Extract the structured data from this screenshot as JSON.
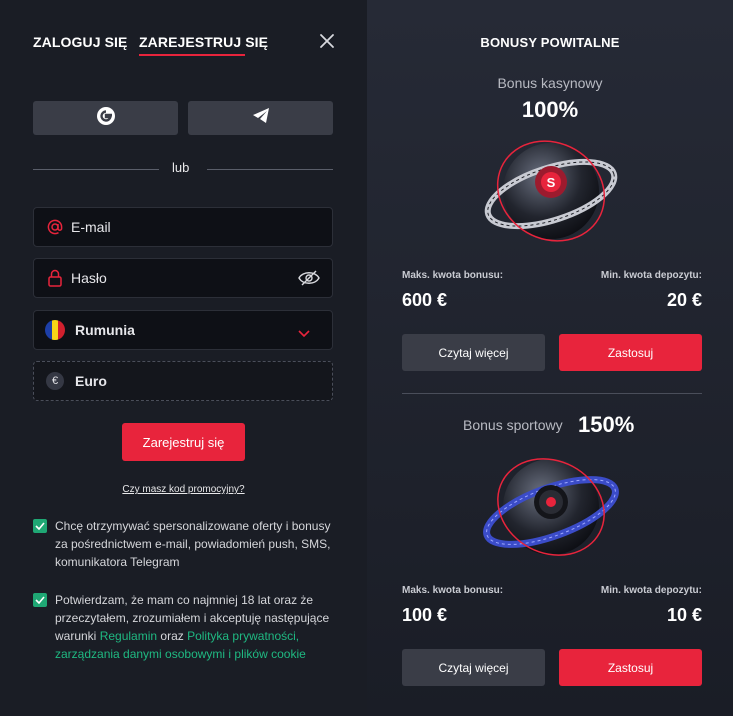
{
  "tabs": {
    "login": "ZALOGUJ SIĘ",
    "register": "ZAREJESTRUJ SIĘ"
  },
  "divider_text": "lub",
  "form": {
    "email_placeholder": "E-mail",
    "password_placeholder": "Hasło",
    "country": "Rumunia",
    "currency": "Euro",
    "currency_symbol": "€",
    "submit": "Zarejestruj się",
    "promo_link": "Czy masz kod promocyjny?"
  },
  "consents": {
    "marketing": "Chcę otrzymywać spersonalizowane oferty i bonusy za pośrednictwem e-mail, powiadomień push, SMS, komunikatora Telegram",
    "terms_prefix": "Potwierdzam, że mam co najmniej 18 lat oraz że przeczytałem, zrozumiałem i akceptuję następujące warunki ",
    "terms_link": "Regulamin",
    "terms_and": " oraz ",
    "privacy_link": "Polityka prywatności, zarządzania danymi osobowymi i plików cookie"
  },
  "bonuses": {
    "title": "BONUSY POWITALNE",
    "casino": {
      "name": "Bonus kasynowy",
      "percent": "100%",
      "max_label": "Maks. kwota bonusu:",
      "max_value": "600 €",
      "min_label": "Min. kwota depozytu:",
      "min_value": "20 €",
      "more": "Czytaj więcej",
      "apply": "Zastosuj"
    },
    "sport": {
      "name": "Bonus sportowy",
      "percent": "150%",
      "max_label": "Maks. kwota bonusu:",
      "max_value": "100 €",
      "min_label": "Min. kwota depozytu:",
      "min_value": "10 €",
      "more": "Czytaj więcej",
      "apply": "Zastosuj"
    }
  },
  "colors": {
    "accent": "#e8243c",
    "check": "#1fa774",
    "link": "#1fb982"
  },
  "icons": [
    "google-icon",
    "telegram-icon",
    "close-icon",
    "at-icon",
    "lock-icon",
    "eye-off-icon",
    "romania-flag-icon",
    "chevron-down-icon",
    "euro-icon",
    "check-icon"
  ]
}
